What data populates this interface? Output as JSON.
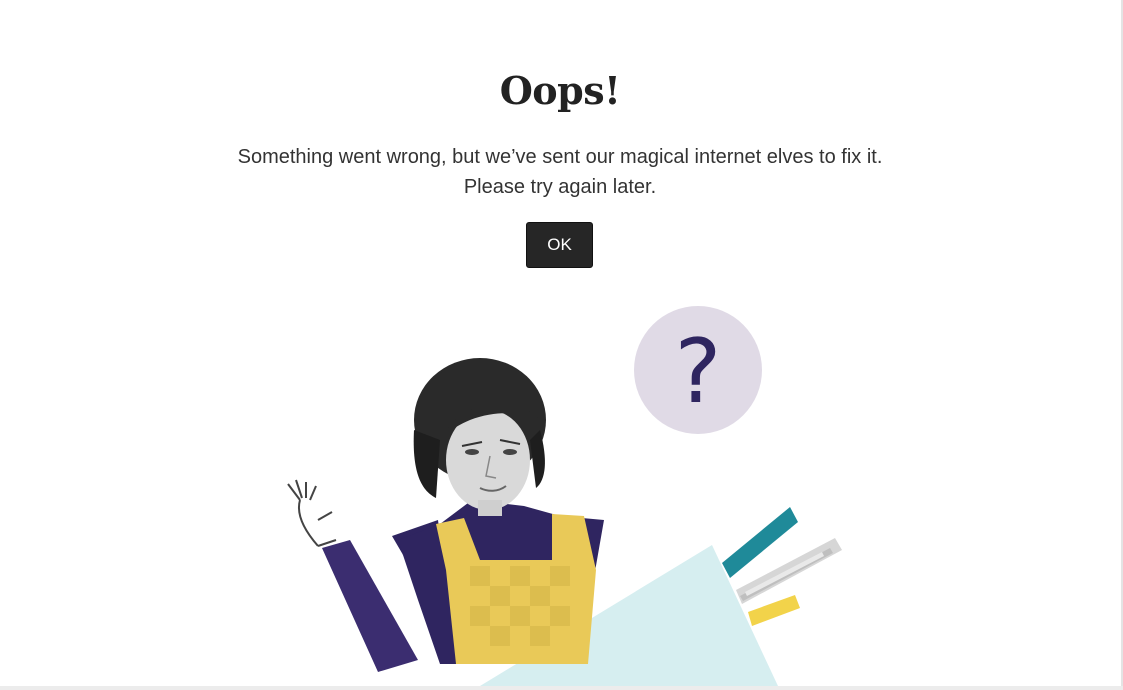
{
  "dialog": {
    "title": "Oops!",
    "message": "Something went wrong, but we’ve sent our magical internet elves to fix it. Please try again later.",
    "ok_label": "OK"
  },
  "illustration": {
    "bubble_glyph": "?",
    "description_icon": "confused-woman-illustration"
  },
  "colors": {
    "button_bg": "#262626",
    "bubble": "#e0dae6",
    "question_mark": "#2f2560",
    "sweater": "#2f2560",
    "apron": "#e9c958",
    "light_beam": "#d6eef0",
    "teal_stripe": "#1f8a99",
    "yellow_stripe": "#f2d34a"
  }
}
